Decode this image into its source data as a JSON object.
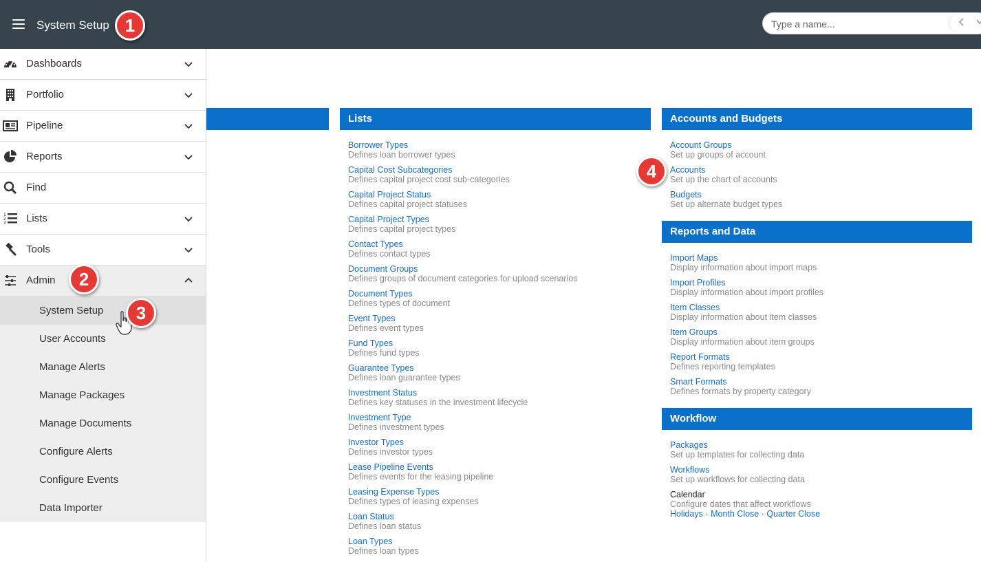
{
  "header": {
    "title": "System Setup",
    "search_placeholder": "Type a name...",
    "bg_color": "#37434d"
  },
  "annotations": [
    "1",
    "2",
    "3",
    "4"
  ],
  "sidebar": {
    "items": [
      {
        "label": "Dashboards",
        "icon": "dashboard-icon"
      },
      {
        "label": "Portfolio",
        "icon": "building-icon"
      },
      {
        "label": "Pipeline",
        "icon": "newspaper-icon"
      },
      {
        "label": "Reports",
        "icon": "pie-chart-icon"
      },
      {
        "label": "Find",
        "icon": "search-icon"
      },
      {
        "label": "Lists",
        "icon": "numbered-list-icon"
      },
      {
        "label": "Tools",
        "icon": "gavel-icon"
      },
      {
        "label": "Admin",
        "icon": "sliders-icon"
      }
    ],
    "admin_subitems": [
      "System Setup",
      "User Accounts",
      "Manage Alerts",
      "Manage Packages",
      "Manage Documents",
      "Configure Alerts",
      "Configure Events",
      "Data Importer"
    ]
  },
  "lists": {
    "header": "Lists",
    "entries": [
      {
        "title": "Borrower Types",
        "desc": "Defines loan borrower types"
      },
      {
        "title": "Capital Cost Subcategories",
        "desc": "Defines capital project cost sub-categories"
      },
      {
        "title": "Capital Project Status",
        "desc": "Defines capital project statuses"
      },
      {
        "title": "Capital Project Types",
        "desc": "Defines capital project types"
      },
      {
        "title": "Contact Types",
        "desc": "Defines contact types"
      },
      {
        "title": "Document Groups",
        "desc": "Defines groups of document categories for upload scenarios"
      },
      {
        "title": "Document Types",
        "desc": "Defines types of document"
      },
      {
        "title": "Event Types",
        "desc": "Defines event types"
      },
      {
        "title": "Fund Types",
        "desc": "Defines fund types"
      },
      {
        "title": "Guarantee Types",
        "desc": "Defines loan guarantee types"
      },
      {
        "title": "Investment Status",
        "desc": "Defines key statuses in the investment lifecycle"
      },
      {
        "title": "Investment Type",
        "desc": "Defines investment types"
      },
      {
        "title": "Investor Types",
        "desc": "Defines investor types"
      },
      {
        "title": "Lease Pipeline Events",
        "desc": "Defines events for the leasing pipeline"
      },
      {
        "title": "Leasing Expense Types",
        "desc": "Defines types of leasing expenses"
      },
      {
        "title": "Loan Status",
        "desc": "Defines loan status"
      },
      {
        "title": "Loan Types",
        "desc": "Defines loan types"
      }
    ]
  },
  "accounts": {
    "header": "Accounts and Budgets",
    "entries": [
      {
        "title": "Account Groups",
        "desc": "Set up groups of account"
      },
      {
        "title": "Accounts",
        "desc": "Set up the chart of accounts"
      },
      {
        "title": "Budgets",
        "desc": "Set up alternate budget types"
      }
    ]
  },
  "reports": {
    "header": "Reports and Data",
    "entries": [
      {
        "title": "Import Maps",
        "desc": "Display information about import maps"
      },
      {
        "title": "Import Profiles",
        "desc": "Display information about import profiles"
      },
      {
        "title": "Item Classes",
        "desc": "Display information about item classes"
      },
      {
        "title": "Item Groups",
        "desc": "Display information about item groups"
      },
      {
        "title": "Report Formats",
        "desc": "Defines reporting templates"
      },
      {
        "title": "Smart Formats",
        "desc": "Defines formats by property category"
      }
    ]
  },
  "workflow": {
    "header": "Workflow",
    "entries": [
      {
        "title": "Packages",
        "desc": "Set up templates for collecting data"
      },
      {
        "title": "Workflows",
        "desc": "Set up workflows for collecting data"
      }
    ],
    "calendar": {
      "title": "Calendar",
      "desc": "Configure dates that affect workflows",
      "links": [
        "Holidays",
        "Month Close",
        "Quarter Close"
      ],
      "separator": "·"
    }
  },
  "colors": {
    "section_header": "#0a70c9",
    "link": "#1b6ec2",
    "badge": "#e53935"
  }
}
